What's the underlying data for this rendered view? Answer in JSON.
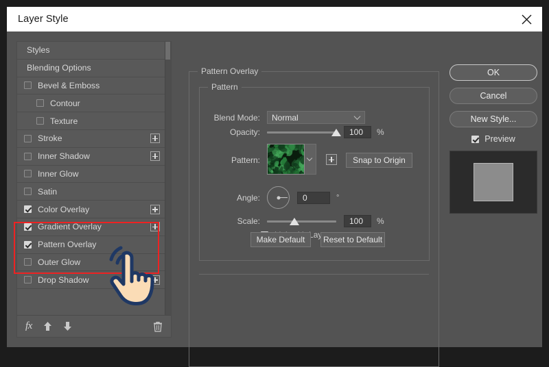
{
  "window": {
    "title": "Layer Style",
    "close_icon": "close-icon"
  },
  "effects_list": {
    "items": [
      {
        "label": "Styles",
        "type": "plain",
        "checked": null,
        "plus": false
      },
      {
        "label": "Blending Options",
        "type": "plain",
        "checked": null,
        "plus": false
      },
      {
        "label": "Bevel & Emboss",
        "type": "checkbox",
        "checked": false,
        "plus": false
      },
      {
        "label": "Contour",
        "type": "indent",
        "checked": false,
        "plus": false
      },
      {
        "label": "Texture",
        "type": "indent",
        "checked": false,
        "plus": false
      },
      {
        "label": "Stroke",
        "type": "checkbox",
        "checked": false,
        "plus": true
      },
      {
        "label": "Inner Shadow",
        "type": "checkbox",
        "checked": false,
        "plus": true
      },
      {
        "label": "Inner Glow",
        "type": "checkbox",
        "checked": false,
        "plus": false
      },
      {
        "label": "Satin",
        "type": "checkbox",
        "checked": false,
        "plus": false
      },
      {
        "label": "Color Overlay",
        "type": "checkbox",
        "checked": true,
        "plus": true
      },
      {
        "label": "Gradient Overlay",
        "type": "checkbox",
        "checked": true,
        "plus": true
      },
      {
        "label": "Pattern Overlay",
        "type": "checkbox",
        "checked": true,
        "plus": false
      },
      {
        "label": "Outer Glow",
        "type": "checkbox",
        "checked": false,
        "plus": false
      },
      {
        "label": "Drop Shadow",
        "type": "checkbox",
        "checked": false,
        "plus": true
      }
    ],
    "highlight_color": "#ee2222",
    "highlighted_labels": [
      "Color Overlay",
      "Gradient Overlay",
      "Pattern Overlay"
    ],
    "toolbar": {
      "fx_label": "fx",
      "fx_icon": "fx-icon",
      "move_up_icon": "arrow-up-icon",
      "move_down_icon": "arrow-down-icon",
      "delete_icon": "trash-icon"
    }
  },
  "panel": {
    "outer_group_title": "Pattern Overlay",
    "inner_group_title": "Pattern",
    "blend_mode": {
      "label": "Blend Mode:",
      "value": "Normal",
      "chevron_icon": "chevron-down-icon"
    },
    "opacity": {
      "label": "Opacity:",
      "value": "100",
      "unit": "%",
      "slider_percent": 100
    },
    "pattern": {
      "label": "Pattern:",
      "swatch_icon": "pattern-swatch",
      "chevron_icon": "chevron-down-icon",
      "new_preset_icon": "plus-square-icon",
      "snap_button": "Snap to Origin"
    },
    "angle": {
      "label": "Angle:",
      "value": "0",
      "unit": "°",
      "dial_icon": "angle-dial",
      "degrees": 0
    },
    "scale": {
      "label": "Scale:",
      "value": "100",
      "unit": "%",
      "slider_percent": 40
    },
    "link_with_layer": {
      "label": "Link with Layer",
      "checked": true
    },
    "make_default_button": "Make Default",
    "reset_default_button": "Reset to Default"
  },
  "right": {
    "ok_button": "OK",
    "cancel_button": "Cancel",
    "new_style_button": "New Style...",
    "preview": {
      "label": "Preview",
      "checked": true
    }
  },
  "cursor": {
    "icon": "pointing-hand-cursor"
  }
}
